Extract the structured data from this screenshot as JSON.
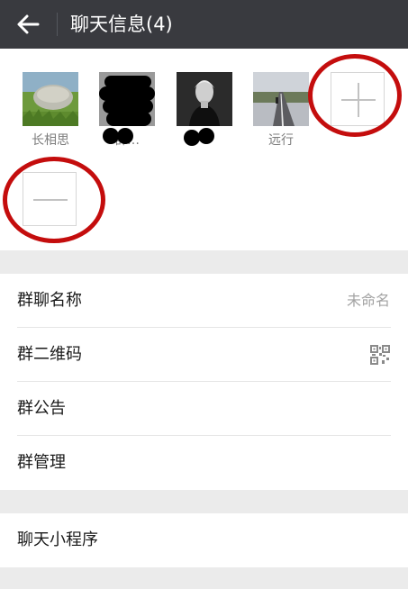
{
  "header": {
    "back_icon": "arrow-left-icon",
    "title": "聊天信息(4)"
  },
  "members": [
    {
      "name": "长相思",
      "avatar": "grass-rock-photo"
    },
    {
      "name": "群…",
      "avatar": "redacted"
    },
    {
      "name": "…",
      "avatar": "dark-portrait-photo"
    },
    {
      "name": "远行",
      "avatar": "road-landscape-photo"
    }
  ],
  "actions": {
    "add_icon": "plus-icon",
    "remove_icon": "minus-icon",
    "highlight_color": "#c40d0d"
  },
  "settings": [
    {
      "label": "群聊名称",
      "value": "未命名"
    },
    {
      "label": "群二维码",
      "value_icon": "qr-code-icon"
    },
    {
      "label": "群公告"
    },
    {
      "label": "群管理"
    }
  ],
  "mini_programs": {
    "label": "聊天小程序"
  },
  "colors": {
    "titlebar": "#393a3f",
    "background": "#ebebeb",
    "accent_red": "#c40d0d"
  }
}
